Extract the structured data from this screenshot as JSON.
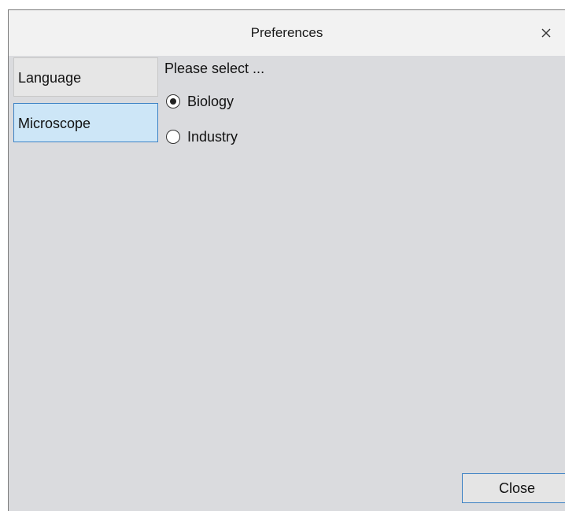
{
  "window": {
    "title": "Preferences",
    "close_icon": "close-icon"
  },
  "sidebar": {
    "items": [
      {
        "label": "Language",
        "selected": false
      },
      {
        "label": "Microscope",
        "selected": true
      }
    ]
  },
  "main": {
    "prompt": "Please select ...",
    "options": [
      {
        "label": "Biology",
        "checked": true
      },
      {
        "label": "Industry",
        "checked": false
      }
    ]
  },
  "footer": {
    "close_label": "Close"
  },
  "colors": {
    "background": "#dadbde",
    "selected_fill": "#cde6f7",
    "accent_border": "#3d82c4"
  }
}
